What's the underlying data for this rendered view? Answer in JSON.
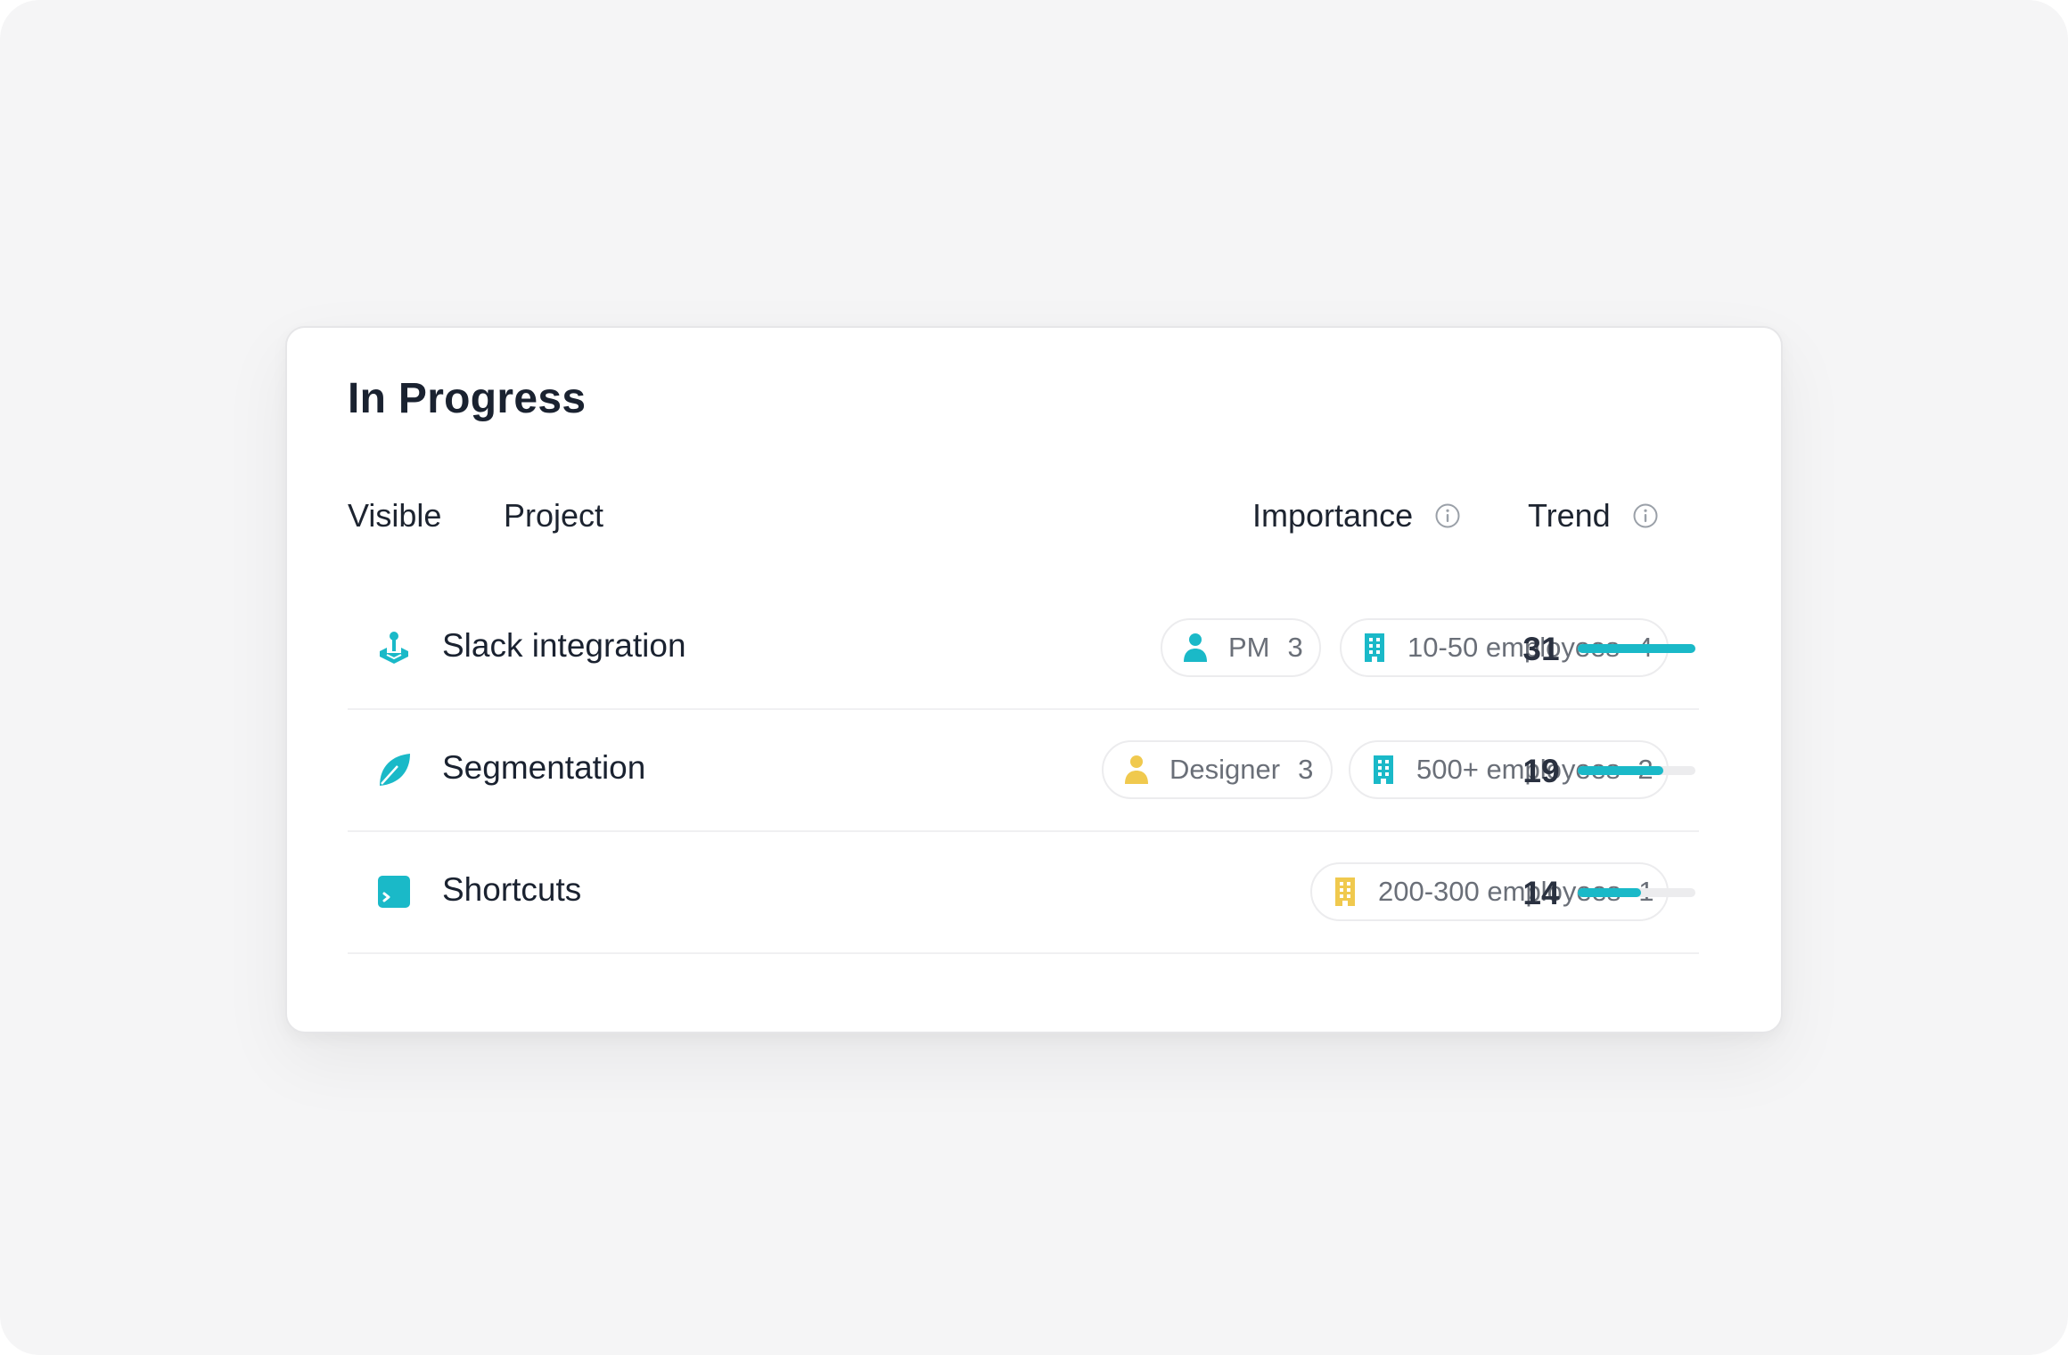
{
  "panel": {
    "title": "In Progress",
    "columns": {
      "visible": "Visible",
      "project": "Project",
      "importance": "Importance",
      "trend": "Trend"
    }
  },
  "colors": {
    "accent_teal": "#1ab9c8",
    "accent_yellow": "#f0c94e",
    "track": "#ececee"
  },
  "rows": [
    {
      "name": "Slack integration",
      "icon": "joystick-icon",
      "chips": [
        {
          "icon": "person-icon",
          "color": "teal",
          "label": "PM",
          "count": "3"
        },
        {
          "icon": "building-icon",
          "color": "teal",
          "label": "10-50 employees",
          "count": "4"
        }
      ],
      "score": "31",
      "trend_fraction": 1.0
    },
    {
      "name": "Segmentation",
      "icon": "leaf-icon",
      "chips": [
        {
          "icon": "person-icon",
          "color": "yellow",
          "label": "Designer",
          "count": "3"
        },
        {
          "icon": "building-icon",
          "color": "teal",
          "label": "500+ employees",
          "count": "2"
        }
      ],
      "score": "19",
      "trend_fraction": 0.73
    },
    {
      "name": "Shortcuts",
      "icon": "terminal-icon",
      "chips": [
        {
          "icon": "building-icon",
          "color": "yellow",
          "label": "200-300 employees",
          "count": "1"
        }
      ],
      "score": "14",
      "trend_fraction": 0.54
    }
  ]
}
